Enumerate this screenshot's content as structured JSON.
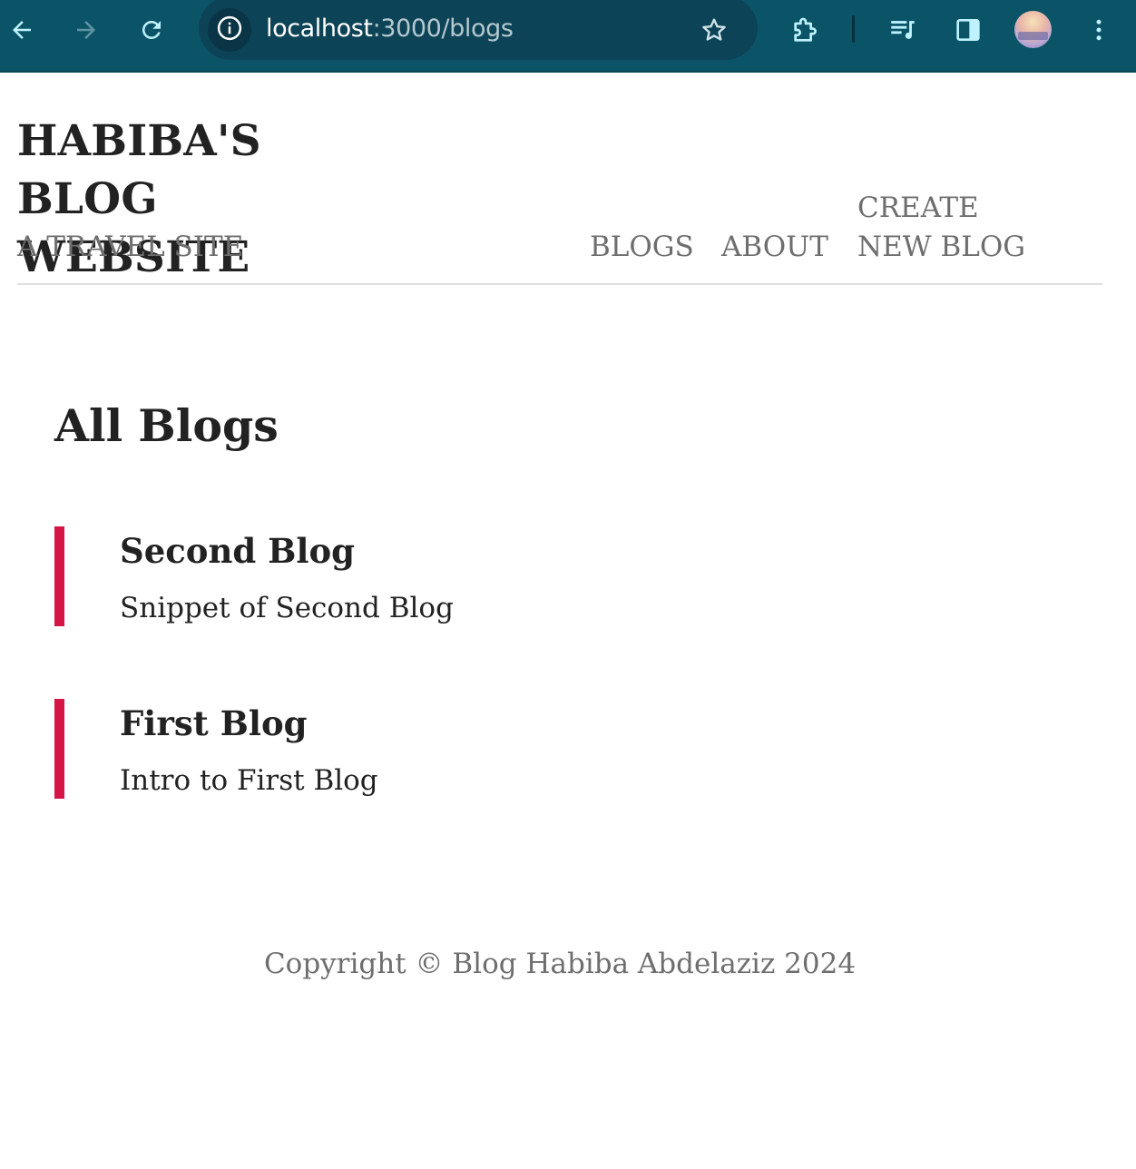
{
  "browser": {
    "url_host": "localhost",
    "url_path": ":3000/blogs",
    "toolbar_color": "#0b5468",
    "icons": {
      "back": "arrow-left-icon",
      "forward": "arrow-right-icon",
      "reload": "reload-icon",
      "site_info": "info-icon",
      "bookmark": "star-icon",
      "extensions": "puzzle-icon",
      "media": "playlist-icon",
      "side_panel": "side-panel-icon",
      "profile": "avatar",
      "menu": "kebab-menu-icon"
    }
  },
  "header": {
    "title": "HABIBA'S BLOG WEBSITE",
    "subtitle": "A TRAVEL SITE",
    "nav": {
      "blogs": "BLOGS",
      "about": "ABOUT",
      "create": "CREATE NEW BLOG"
    }
  },
  "main": {
    "heading": "All Blogs",
    "accent_color": "#d41545",
    "blogs": [
      {
        "title": "Second Blog",
        "snippet": "Snippet of Second Blog"
      },
      {
        "title": "First Blog",
        "snippet": "Intro to First Blog"
      }
    ]
  },
  "footer": {
    "copyright": "Copyright © Blog Habiba Abdelaziz 2024"
  }
}
